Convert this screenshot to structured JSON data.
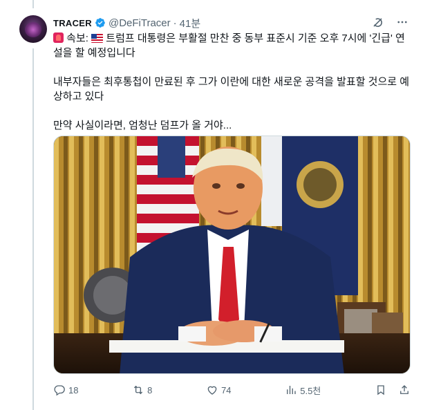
{
  "tweet": {
    "author_name": "TRACER",
    "handle": "@DeFiTracer",
    "separator": "·",
    "time": "41분",
    "paragraphs": [
      {
        "prefix_label": "속보:",
        "text": "트럼프 대통령은 부활절 만찬 중 동부 표준시 기준 오후 7시에 '긴급' 연설을 할 예정입니다"
      },
      {
        "text": "내부자들은 최후통첩이 만료된 후 그가 이란에 대한 새로운 공격을 발표할 것으로 예상하고 있다"
      },
      {
        "text": "만약 사실이라면, 엄청난 덤프가 올 거야..."
      }
    ],
    "image_description_icon": "photo"
  },
  "actions": {
    "reply_count": "18",
    "retweet_count": "8",
    "like_count": "74",
    "views_count": "5.5천"
  },
  "icons": {
    "grok": "grok-icon",
    "more": "more-icon",
    "reply": "reply-icon",
    "retweet": "retweet-icon",
    "like": "heart-icon",
    "views": "views-icon",
    "bookmark": "bookmark-icon",
    "share": "share-icon"
  },
  "colors": {
    "text_primary": "#0f1419",
    "text_secondary": "#536471",
    "verified_blue": "#1d9bf0",
    "border": "#cfd9de"
  }
}
